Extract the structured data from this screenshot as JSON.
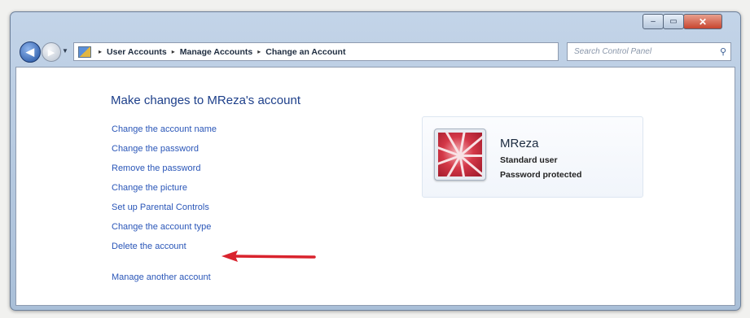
{
  "window": {
    "controls": {
      "minimize": "–",
      "maximize": "▭",
      "close": "✕"
    }
  },
  "nav": {
    "back": "◀",
    "forward": "▶",
    "breadcrumbs": [
      "User Accounts",
      "Manage Accounts",
      "Change an Account"
    ],
    "separator": "▸",
    "search_placeholder": "Search Control Panel"
  },
  "content": {
    "title": "Make changes to MReza's account",
    "tasks": [
      "Change the account name",
      "Change the password",
      "Remove the password",
      "Change the picture",
      "Set up Parental Controls",
      "Change the account type",
      "Delete the account"
    ],
    "manage_link": "Manage another account"
  },
  "user_card": {
    "name": "MReza",
    "type": "Standard user",
    "password_status": "Password protected"
  },
  "icons": [
    "back-icon",
    "forward-icon",
    "control-panel-icon",
    "refresh-icon",
    "search-icon",
    "user-avatar",
    "red-arrow-annotation"
  ],
  "colors": {
    "link": "#2a56b8",
    "title": "#1d3f8a",
    "arrow": "#d9232d"
  }
}
